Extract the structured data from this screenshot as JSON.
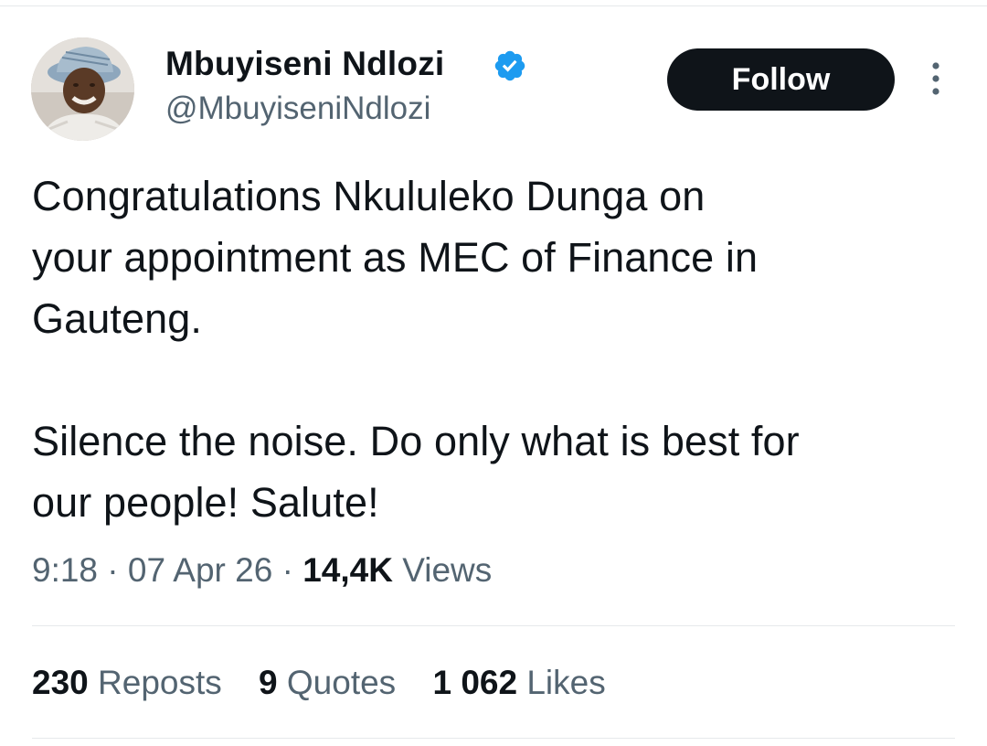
{
  "author": {
    "display_name": "Mbuyiseni Ndlozi",
    "handle": "@MbuyiseniNdlozi",
    "verified": true,
    "avatar_icon": "profile-photo"
  },
  "follow_label": "Follow",
  "more_icon": "more-vertical-icon",
  "tweet": {
    "paragraph_1": "Congratulations Nkululeko Dunga on\nyour appointment as MEC of Finance in\nGauteng.",
    "paragraph_2": "Silence the noise. Do only what is best for\nour people! Salute!"
  },
  "meta": {
    "time": "9:18",
    "sep1": "·",
    "date": "07 Apr 26",
    "sep2": "·",
    "views_count": "14,4K",
    "views_label": "Views"
  },
  "stats": {
    "reposts_count": "230",
    "reposts_label": "Reposts",
    "quotes_count": "9",
    "quotes_label": "Quotes",
    "likes_count": "1 062",
    "likes_label": "Likes"
  },
  "colors": {
    "text_primary": "#0f1419",
    "text_secondary": "#536471",
    "verified_blue": "#1d9bf0",
    "follow_button_bg": "#0f1419",
    "divider": "#e6e9eb"
  }
}
